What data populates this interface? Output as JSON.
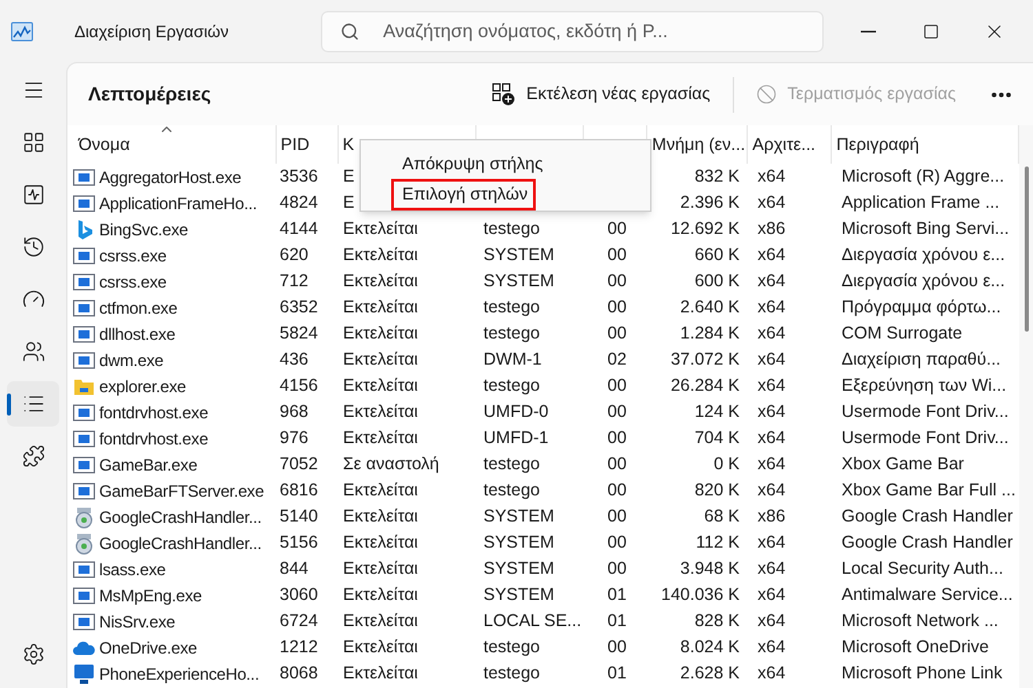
{
  "window": {
    "title": "Διαχείριση Εργασιών"
  },
  "search": {
    "placeholder": "Αναζήτηση ονόματος, εκδότη ή P..."
  },
  "sidebar": {
    "items": [
      {
        "kind": "menu",
        "selected": false
      },
      {
        "kind": "processes",
        "selected": false
      },
      {
        "kind": "performance",
        "selected": false
      },
      {
        "kind": "history",
        "selected": false
      },
      {
        "kind": "startup",
        "selected": false
      },
      {
        "kind": "users",
        "selected": false
      },
      {
        "kind": "details",
        "selected": true
      },
      {
        "kind": "services",
        "selected": false
      },
      {
        "kind": "settings",
        "selected": false
      }
    ]
  },
  "toolbar": {
    "title": "Λεπτομέρειες",
    "buttons": [
      {
        "kind": "run",
        "label": "Εκτέλεση νέας εργασίας",
        "disabled": false
      },
      {
        "kind": "end",
        "label": "Τερματισμός εργασίας",
        "disabled": true
      }
    ]
  },
  "table": {
    "columns": [
      {
        "label": "Όνομα",
        "sorted": true
      },
      {
        "label": "PID",
        "sorted": false
      },
      {
        "label": "K",
        "sorted": false
      },
      {},
      {},
      {
        "label": "Μνήμη (εν...",
        "sorted": false
      },
      {
        "label": "Αρχιτε...",
        "sorted": false
      },
      {
        "label": "Περιγραφή",
        "sorted": false
      }
    ],
    "rows": [
      {
        "kind": "app",
        "cells": [
          "AggregatorHost.exe",
          "3536",
          "Ε",
          null,
          null,
          "832 K",
          "x64",
          "Microsoft (R) Aggre..."
        ]
      },
      {
        "kind": "app",
        "cells": [
          "ApplicationFrameHo...",
          "4824",
          "Ε",
          null,
          null,
          "2.396 K",
          "x64",
          "Application Frame ..."
        ]
      },
      {
        "kind": "bing",
        "cells": [
          "BingSvc.exe",
          "4144",
          "Εκτελείται",
          "testego",
          "00",
          "12.692 K",
          "x86",
          "Microsoft Bing Servi..."
        ]
      },
      {
        "kind": "app",
        "cells": [
          "csrss.exe",
          "620",
          "Εκτελείται",
          "SYSTEM",
          "00",
          "660 K",
          "x64",
          "Διεργασία χρόνου ε..."
        ]
      },
      {
        "kind": "app",
        "cells": [
          "csrss.exe",
          "712",
          "Εκτελείται",
          "SYSTEM",
          "00",
          "600 K",
          "x64",
          "Διεργασία χρόνου ε..."
        ]
      },
      {
        "kind": "app",
        "cells": [
          "ctfmon.exe",
          "6352",
          "Εκτελείται",
          "testego",
          "00",
          "2.640 K",
          "x64",
          "Πρόγραμμα φόρτω..."
        ]
      },
      {
        "kind": "app",
        "cells": [
          "dllhost.exe",
          "5824",
          "Εκτελείται",
          "testego",
          "00",
          "1.284 K",
          "x64",
          "COM Surrogate"
        ]
      },
      {
        "kind": "app",
        "cells": [
          "dwm.exe",
          "436",
          "Εκτελείται",
          "DWM-1",
          "02",
          "37.072 K",
          "x64",
          "Διαχείριση παραθύ..."
        ]
      },
      {
        "kind": "folder",
        "cells": [
          "explorer.exe",
          "4156",
          "Εκτελείται",
          "testego",
          "00",
          "26.284 K",
          "x64",
          "Εξερεύνηση των Wi..."
        ]
      },
      {
        "kind": "app",
        "cells": [
          "fontdrvhost.exe",
          "968",
          "Εκτελείται",
          "UMFD-0",
          "00",
          "124 K",
          "x64",
          "Usermode Font Driv..."
        ]
      },
      {
        "kind": "app",
        "cells": [
          "fontdrvhost.exe",
          "976",
          "Εκτελείται",
          "UMFD-1",
          "00",
          "704 K",
          "x64",
          "Usermode Font Driv..."
        ]
      },
      {
        "kind": "app",
        "cells": [
          "GameBar.exe",
          "7052",
          "Σε αναστολή",
          "testego",
          "00",
          "0 K",
          "x64",
          "Xbox Game Bar"
        ]
      },
      {
        "kind": "app",
        "cells": [
          "GameBarFTServer.exe",
          "6816",
          "Εκτελείται",
          "testego",
          "00",
          "820 K",
          "x64",
          "Xbox Game Bar Full ..."
        ]
      },
      {
        "kind": "google",
        "cells": [
          "GoogleCrashHandler...",
          "5140",
          "Εκτελείται",
          "SYSTEM",
          "00",
          "68 K",
          "x86",
          "Google Crash Handler"
        ]
      },
      {
        "kind": "google",
        "cells": [
          "GoogleCrashHandler...",
          "5156",
          "Εκτελείται",
          "SYSTEM",
          "00",
          "112 K",
          "x64",
          "Google Crash Handler"
        ]
      },
      {
        "kind": "app",
        "cells": [
          "lsass.exe",
          "844",
          "Εκτελείται",
          "SYSTEM",
          "00",
          "3.948 K",
          "x64",
          "Local Security Auth..."
        ]
      },
      {
        "kind": "app",
        "cells": [
          "MsMpEng.exe",
          "3060",
          "Εκτελείται",
          "SYSTEM",
          "01",
          "140.036 K",
          "x64",
          "Antimalware Service..."
        ]
      },
      {
        "kind": "app",
        "cells": [
          "NisSrv.exe",
          "6724",
          "Εκτελείται",
          "LOCAL SE...",
          "01",
          "828 K",
          "x64",
          "Microsoft Network ..."
        ]
      },
      {
        "kind": "cloud",
        "cells": [
          "OneDrive.exe",
          "1212",
          "Εκτελείται",
          "testego",
          "00",
          "8.024 K",
          "x64",
          "Microsoft OneDrive"
        ]
      },
      {
        "kind": "phone",
        "cells": [
          "PhoneExperienceHo...",
          "8068",
          "Εκτελείται",
          "testego",
          "01",
          "2.628 K",
          "x64",
          "Microsoft Phone Link"
        ]
      }
    ]
  },
  "context_menu": {
    "items": [
      {
        "label": "Απόκρυψη στήλης",
        "highlighted": false
      },
      {
        "label": "Επιλογή στηλών",
        "highlighted": true
      }
    ]
  }
}
